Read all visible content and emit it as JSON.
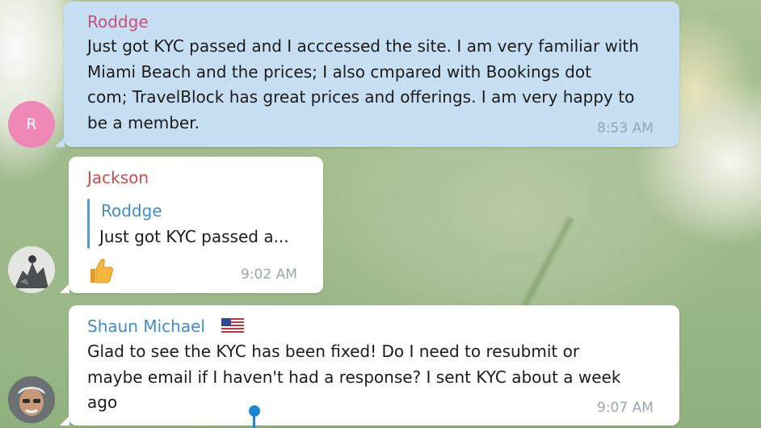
{
  "messages": [
    {
      "author": "Roddge",
      "avatar_letter": "R",
      "text": "Just got KYC passed and I acccessed the site. I am very familiar with\nMiami Beach and the prices; I also cmpared with Bookings dot\ncom; TravelBlock has great prices and offerings. I am very happy to\nbe a member.",
      "time": "8:53 AM",
      "colors": {
        "name": "#c9507a",
        "bubble": "#c7dff2",
        "avatar": "#ef88b7"
      }
    },
    {
      "author": "Jackson",
      "reply_to": {
        "author": "Roddge",
        "snippet": "Just got KYC passed a..."
      },
      "reaction_icon": "thumbs-up-icon",
      "time": "9:02 AM",
      "colors": {
        "name": "#c94c48",
        "reply_accent": "#4fa0d4"
      }
    },
    {
      "author": "Shaun Michael",
      "author_badge_icon": "us-flag-icon",
      "text": "Glad to see the KYC has been fixed! Do I need to resubmit or\nmaybe email if I haven't had a response? I sent KYC about a week\nago",
      "time": "9:07 AM",
      "colors": {
        "name": "#3e8fc7"
      }
    }
  ]
}
